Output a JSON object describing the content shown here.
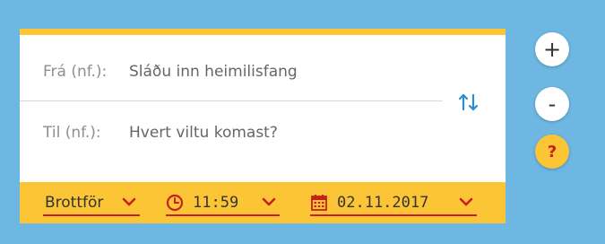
{
  "route": {
    "from": {
      "label": "Frá (nf.):",
      "placeholder": "Sláðu inn heimilisfang"
    },
    "to": {
      "label": "Til (nf.):",
      "placeholder": "Hvert viltu komast?"
    }
  },
  "options": {
    "departure": "Brottför",
    "time": "11:59",
    "date": "02.11.2017"
  },
  "zoom": {
    "in_label": "+",
    "out_label": "-",
    "help_label": "?"
  },
  "colors": {
    "background": "#6db7e2",
    "accent": "#fcc535",
    "red": "#c71f1f"
  },
  "icons": [
    "swap-icon",
    "clock-icon",
    "calendar-icon",
    "chevron-down-icon"
  ]
}
